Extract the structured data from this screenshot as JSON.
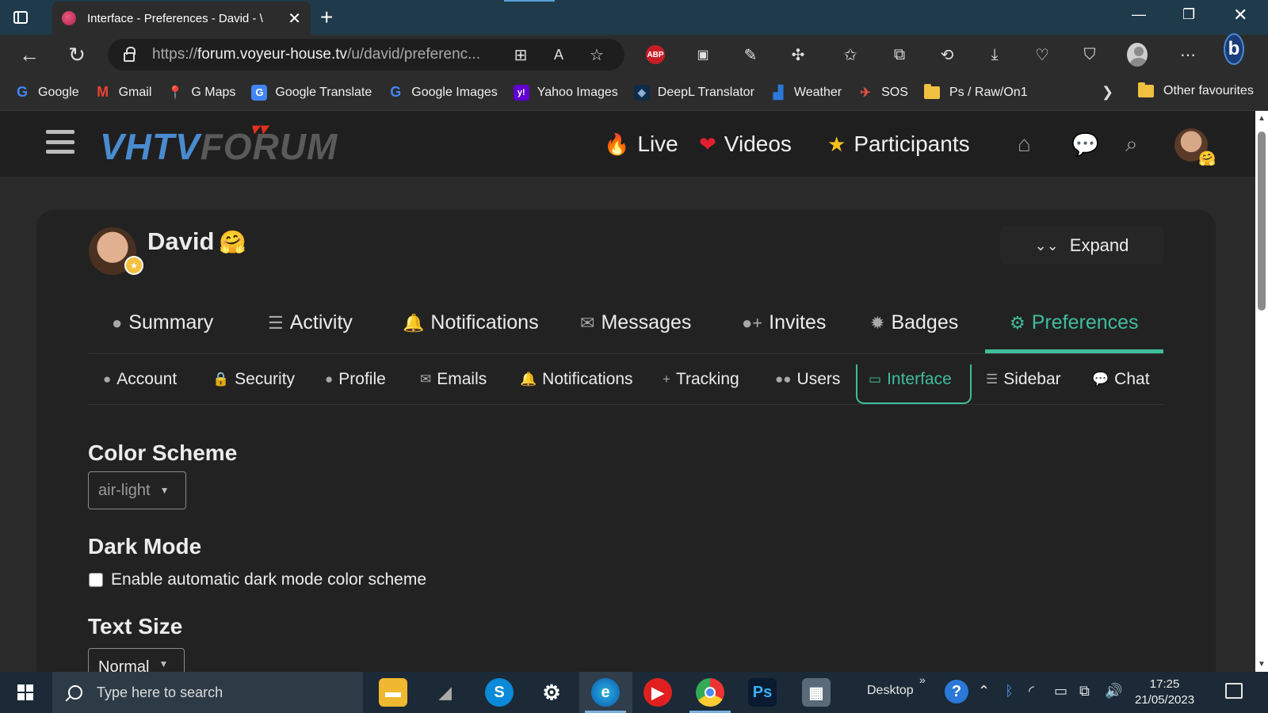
{
  "browser": {
    "tab_title": "Interface - Preferences - David - VHTV Forum",
    "tab_title_visible": "Interface - Preferences - David - \\",
    "url_prefix": "https://",
    "url_host": "forum.voyeur-house.tv",
    "url_path": "/u/david/preferenc...",
    "abp_label": "ABP"
  },
  "bookmarks": [
    {
      "label": "Google",
      "icon": "google-icon",
      "color": "#4285f4",
      "glyph": "G"
    },
    {
      "label": "Gmail",
      "icon": "gmail-icon",
      "color": "#ea4335",
      "glyph": "M"
    },
    {
      "label": "G Maps",
      "icon": "maps-pin-icon",
      "color": "#34a853",
      "glyph": "●"
    },
    {
      "label": "Google Translate",
      "icon": "translate-icon",
      "color": "#4285f4",
      "glyph": "G"
    },
    {
      "label": "Google Images",
      "icon": "google-icon",
      "color": "#4285f4",
      "glyph": "G"
    },
    {
      "label": "Yahoo Images",
      "icon": "yahoo-icon",
      "color": "#6001d2",
      "glyph": "y!"
    },
    {
      "label": "DeepL Translator",
      "icon": "deepl-icon",
      "color": "#0f2b46",
      "glyph": "◆"
    },
    {
      "label": "Weather",
      "icon": "weather-icon",
      "color": "#2a78d8",
      "glyph": "▟"
    },
    {
      "label": "SOS",
      "icon": "sos-icon",
      "color": "#555555",
      "glyph": "✈"
    },
    {
      "label": "Ps / Raw/On1",
      "icon": "folder-icon",
      "color": "#f0c040",
      "glyph": ""
    }
  ],
  "bookmarks_other": "Other favourites",
  "site": {
    "logo_left": "VHTV",
    "logo_right": "FORUM",
    "nav": [
      {
        "label": "Live",
        "emoji": "🔥"
      },
      {
        "label": "Videos",
        "emoji": "❤️"
      },
      {
        "label": "Participants",
        "emoji": "⭐"
      }
    ]
  },
  "user": {
    "name": "David",
    "emoji": "🤗",
    "expand_label": "Expand"
  },
  "main_tabs": [
    {
      "label": "Summary",
      "icon": "user-icon",
      "glyph": "👤"
    },
    {
      "label": "Activity",
      "icon": "list-icon",
      "glyph": "☰"
    },
    {
      "label": "Notifications",
      "icon": "bell-icon",
      "glyph": "🔔"
    },
    {
      "label": "Messages",
      "icon": "envelope-icon",
      "glyph": "✉"
    },
    {
      "label": "Invites",
      "icon": "user-plus-icon",
      "glyph": "👤"
    },
    {
      "label": "Badges",
      "icon": "certificate-icon",
      "glyph": "✹"
    },
    {
      "label": "Preferences",
      "icon": "gear-icon",
      "glyph": "⚙",
      "active": true
    }
  ],
  "sub_tabs": [
    {
      "label": "Account",
      "icon": "user-icon",
      "glyph": "👤"
    },
    {
      "label": "Security",
      "icon": "lock-icon",
      "glyph": "🔒"
    },
    {
      "label": "Profile",
      "icon": "user-icon",
      "glyph": "👤"
    },
    {
      "label": "Emails",
      "icon": "envelope-icon",
      "glyph": "✉"
    },
    {
      "label": "Notifications",
      "icon": "bell-icon",
      "glyph": "🔔"
    },
    {
      "label": "Tracking",
      "icon": "plus-icon",
      "glyph": "+"
    },
    {
      "label": "Users",
      "icon": "users-icon",
      "glyph": "👥"
    },
    {
      "label": "Interface",
      "icon": "desktop-icon",
      "glyph": "🖵",
      "active": true
    },
    {
      "label": "Sidebar",
      "icon": "bars-icon",
      "glyph": "☰"
    },
    {
      "label": "Chat",
      "icon": "comment-icon",
      "glyph": "💬"
    }
  ],
  "settings": {
    "color_scheme": {
      "title": "Color Scheme",
      "value": "air-light"
    },
    "dark_mode": {
      "title": "Dark Mode",
      "checkbox_label": "Enable automatic dark mode color scheme",
      "checked": false
    },
    "text_size": {
      "title": "Text Size",
      "value": "Normal"
    }
  },
  "taskbar": {
    "search_placeholder": "Type here to search",
    "desktop_label": "Desktop",
    "time": "17:25",
    "date": "21/05/2023"
  },
  "colors": {
    "accent": "#3fbd9a",
    "header_bg": "#1f1f1f",
    "page_bg": "#2a2a2a"
  }
}
